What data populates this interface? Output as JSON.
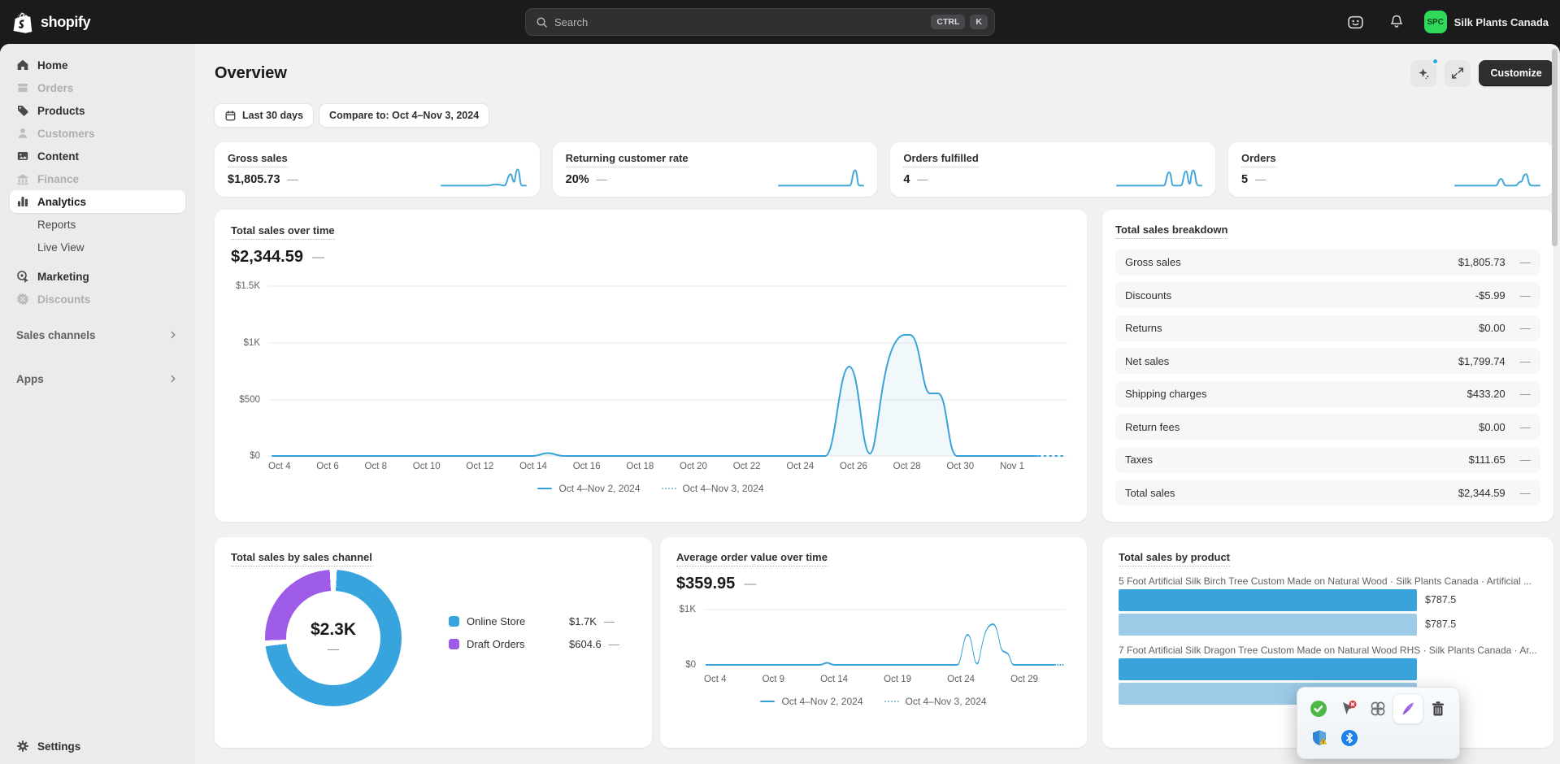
{
  "topbar": {
    "brand": "shopify",
    "search": {
      "placeholder": "Search",
      "kbd1": "CTRL",
      "kbd2": "K"
    },
    "store": {
      "initials": "SPC",
      "name": "Silk Plants Canada"
    }
  },
  "sidebar": {
    "items": [
      {
        "label": "Home"
      },
      {
        "label": "Orders"
      },
      {
        "label": "Products"
      },
      {
        "label": "Customers"
      },
      {
        "label": "Content"
      },
      {
        "label": "Finance"
      },
      {
        "label": "Analytics"
      },
      {
        "label": "Reports"
      },
      {
        "label": "Live View"
      },
      {
        "label": "Marketing"
      },
      {
        "label": "Discounts"
      }
    ],
    "sections": [
      {
        "label": "Sales channels"
      },
      {
        "label": "Apps"
      }
    ],
    "settings_label": "Settings"
  },
  "header": {
    "title": "Overview",
    "customize_label": "Customize"
  },
  "filters": {
    "date_range": "Last 30 days",
    "compare": "Compare to: Oct 4–Nov 3, 2024"
  },
  "metric_cards": [
    {
      "label": "Gross sales",
      "value": "$1,805.73",
      "delta": "—"
    },
    {
      "label": "Returning customer rate",
      "value": "20%",
      "delta": "—"
    },
    {
      "label": "Orders fulfilled",
      "value": "4",
      "delta": "—"
    },
    {
      "label": "Orders",
      "value": "5",
      "delta": "—"
    }
  ],
  "total_sales_chart": {
    "title": "Total sales over time",
    "value": "$2,344.59",
    "delta": "—",
    "y_ticks": [
      "$1.5K",
      "$1K",
      "$500",
      "$0"
    ],
    "x_ticks": [
      "Oct 4",
      "Oct 6",
      "Oct 8",
      "Oct 10",
      "Oct 12",
      "Oct 14",
      "Oct 16",
      "Oct 18",
      "Oct 20",
      "Oct 22",
      "Oct 24",
      "Oct 26",
      "Oct 28",
      "Oct 30",
      "Nov 1"
    ],
    "legend": [
      {
        "label": "Oct 4–Nov 2, 2024"
      },
      {
        "label": "Oct 4–Nov 3, 2024"
      }
    ]
  },
  "breakdown": {
    "title": "Total sales breakdown",
    "rows": [
      {
        "label": "Gross sales",
        "value": "$1,805.73",
        "delta": "—"
      },
      {
        "label": "Discounts",
        "value": "-$5.99",
        "delta": "—"
      },
      {
        "label": "Returns",
        "value": "$0.00",
        "delta": "—"
      },
      {
        "label": "Net sales",
        "value": "$1,799.74",
        "delta": "—"
      },
      {
        "label": "Shipping charges",
        "value": "$433.20",
        "delta": "—"
      },
      {
        "label": "Return fees",
        "value": "$0.00",
        "delta": "—"
      },
      {
        "label": "Taxes",
        "value": "$111.65",
        "delta": "—"
      },
      {
        "label": "Total sales",
        "value": "$2,344.59",
        "delta": "—"
      }
    ]
  },
  "channel_chart": {
    "title": "Total sales by sales channel",
    "center_value": "$2.3K",
    "center_delta": "—",
    "legend": [
      {
        "label": "Online Store",
        "value": "$1.7K",
        "delta": "—",
        "color": "#38A4DE"
      },
      {
        "label": "Draft Orders",
        "value": "$604.6",
        "delta": "—",
        "color": "#9D5BE8"
      }
    ]
  },
  "aov_chart": {
    "title": "Average order value over time",
    "value": "$359.95",
    "delta": "—",
    "y_ticks": [
      "$1K",
      "$0"
    ],
    "x_ticks": [
      "Oct 4",
      "Oct 9",
      "Oct 14",
      "Oct 19",
      "Oct 24",
      "Oct 29"
    ],
    "legend": [
      {
        "label": "Oct 4–Nov 2, 2024"
      },
      {
        "label": "Oct 4–Nov 3, 2024"
      }
    ]
  },
  "product_chart": {
    "title": "Total sales by product",
    "products": [
      {
        "name": "5 Foot Artificial Silk Birch Tree Custom Made on Natural Wood · Silk Plants Canada · Artificial ...",
        "bar1_value": "$787.5",
        "bar2_value": "$787.5"
      },
      {
        "name": "7 Foot Artificial Silk Dragon Tree Custom Made on Natural Wood RHS · Silk Plants Canada · Ar...",
        "bar1_value": "",
        "bar2_value": ""
      }
    ]
  },
  "tray_popup": {
    "icons": [
      "antivirus-check",
      "pin-alert",
      "clover",
      "pen",
      "trash",
      "shield-warning",
      "bluetooth"
    ],
    "selected": "pen"
  },
  "chart_data": [
    {
      "type": "line",
      "title": "Total sales over time",
      "total_label": "$2,344.59",
      "ylim": [
        0,
        1500
      ],
      "y_tick_labels": [
        "$0",
        "$500",
        "$1K",
        "$1.5K"
      ],
      "x_range": [
        "Oct 4, 2024",
        "Nov 3, 2024"
      ],
      "legend_position": "bottom-center",
      "grid": true,
      "series": [
        {
          "name": "Oct 4–Nov 2, 2024",
          "style": "solid",
          "points": [
            [
              "Oct 4",
              0
            ],
            [
              "Oct 13",
              0
            ],
            [
              "Oct 14",
              25
            ],
            [
              "Oct 15",
              0
            ],
            [
              "Oct 25",
              0
            ],
            [
              "Oct 26",
              800
            ],
            [
              "Oct 27",
              20
            ],
            [
              "Oct 28",
              1080
            ],
            [
              "Oct 29",
              560
            ],
            [
              "Oct 30",
              0
            ],
            [
              "Nov 2",
              0
            ]
          ]
        },
        {
          "name": "Oct 4–Nov 3, 2024",
          "style": "dotted",
          "points": [
            [
              "Nov 2",
              0
            ],
            [
              "Nov 3",
              0
            ]
          ]
        }
      ]
    },
    {
      "type": "pie",
      "title": "Total sales by sales channel",
      "center_label": "$2.3K",
      "slices": [
        {
          "label": "Online Store",
          "value_label": "$1.7K",
          "approx_value": 1740,
          "color": "#38A4DE"
        },
        {
          "label": "Draft Orders",
          "value_label": "$604.6",
          "approx_value": 604.6,
          "color": "#9D5BE8"
        }
      ]
    },
    {
      "type": "line",
      "title": "Average order value over time",
      "total_label": "$359.95",
      "ylim": [
        0,
        1000
      ],
      "y_tick_labels": [
        "$0",
        "$1K"
      ],
      "x_range": [
        "Oct 4, 2024",
        "Nov 3, 2024"
      ],
      "series": [
        {
          "name": "Oct 4–Nov 2, 2024",
          "style": "solid",
          "points": [
            [
              "Oct 4",
              0
            ],
            [
              "Oct 13",
              0
            ],
            [
              "Oct 14",
              20
            ],
            [
              "Oct 15",
              0
            ],
            [
              "Oct 25",
              0
            ],
            [
              "Oct 26",
              550
            ],
            [
              "Oct 27",
              30
            ],
            [
              "Oct 28",
              740
            ],
            [
              "Oct 29",
              230
            ],
            [
              "Oct 30",
              0
            ],
            [
              "Nov 2",
              0
            ]
          ]
        },
        {
          "name": "Oct 4–Nov 3, 2024",
          "style": "dotted",
          "points": [
            [
              "Nov 2",
              0
            ],
            [
              "Nov 3",
              0
            ]
          ]
        }
      ]
    },
    {
      "type": "bar",
      "title": "Total sales by product",
      "orientation": "horizontal",
      "items": [
        {
          "name": "5 Foot Artificial Silk Birch Tree Custom Made on Natural Wood · Silk Plants Canada · Artificial ...",
          "bars": [
            {
              "series": "Oct 4–Nov 2, 2024",
              "value": 787.5
            },
            {
              "series": "Oct 4–Nov 3, 2024",
              "value": 787.5
            }
          ]
        },
        {
          "name": "7 Foot Artificial Silk Dragon Tree Custom Made on Natural Wood RHS · Silk Plants Canada · Ar...",
          "bars": [
            {
              "series": "Oct 4–Nov 2, 2024",
              "value": null
            },
            {
              "series": "Oct 4–Nov 3, 2024",
              "value": null
            }
          ]
        }
      ]
    }
  ]
}
